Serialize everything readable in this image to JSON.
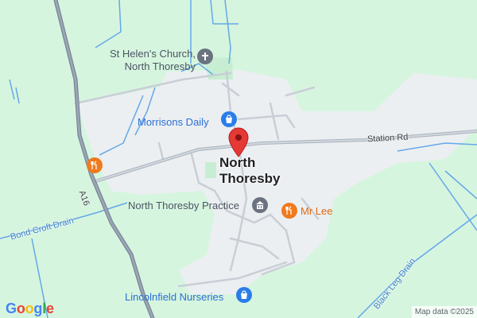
{
  "colors": {
    "land": "#d6f5df",
    "settlement": "#eceff1",
    "road_major": "#8b97a6",
    "road_minor": "#c9ced6",
    "water": "#64a8e8",
    "poi_orange": "#f07a1e",
    "poi_blue": "#2b7de9",
    "poi_gray": "#6b7280",
    "pin_red": "#e53935"
  },
  "place": {
    "name_line1": "North",
    "name_line2": "Thoresby"
  },
  "pois": [
    {
      "label_line1": "St Helen's Church,",
      "label_line2": "North Thoresby",
      "icon": "church-icon",
      "category": "place-of-worship"
    },
    {
      "label": "Morrisons Daily",
      "icon": "shopping-bag-icon",
      "category": "shop"
    },
    {
      "label": "North Thoresby Practice",
      "icon": "medical-building-icon",
      "category": "health"
    },
    {
      "label": "Mr Lee",
      "icon": "restaurant-icon",
      "category": "restaurant"
    },
    {
      "label": "Lincolnfield Nurseries",
      "icon": "shopping-bag-icon",
      "category": "shop"
    },
    {
      "label": "",
      "icon": "restaurant-icon",
      "category": "restaurant"
    }
  ],
  "roads": {
    "station_rd": "Station Rd",
    "a16": "A16"
  },
  "waterways": {
    "bond_croft_drain": "Bond Croft Drain",
    "black_leg_drain": "Black Leg Drain"
  },
  "branding": {
    "logo": "Google",
    "attribution": "Map data ©2025"
  }
}
